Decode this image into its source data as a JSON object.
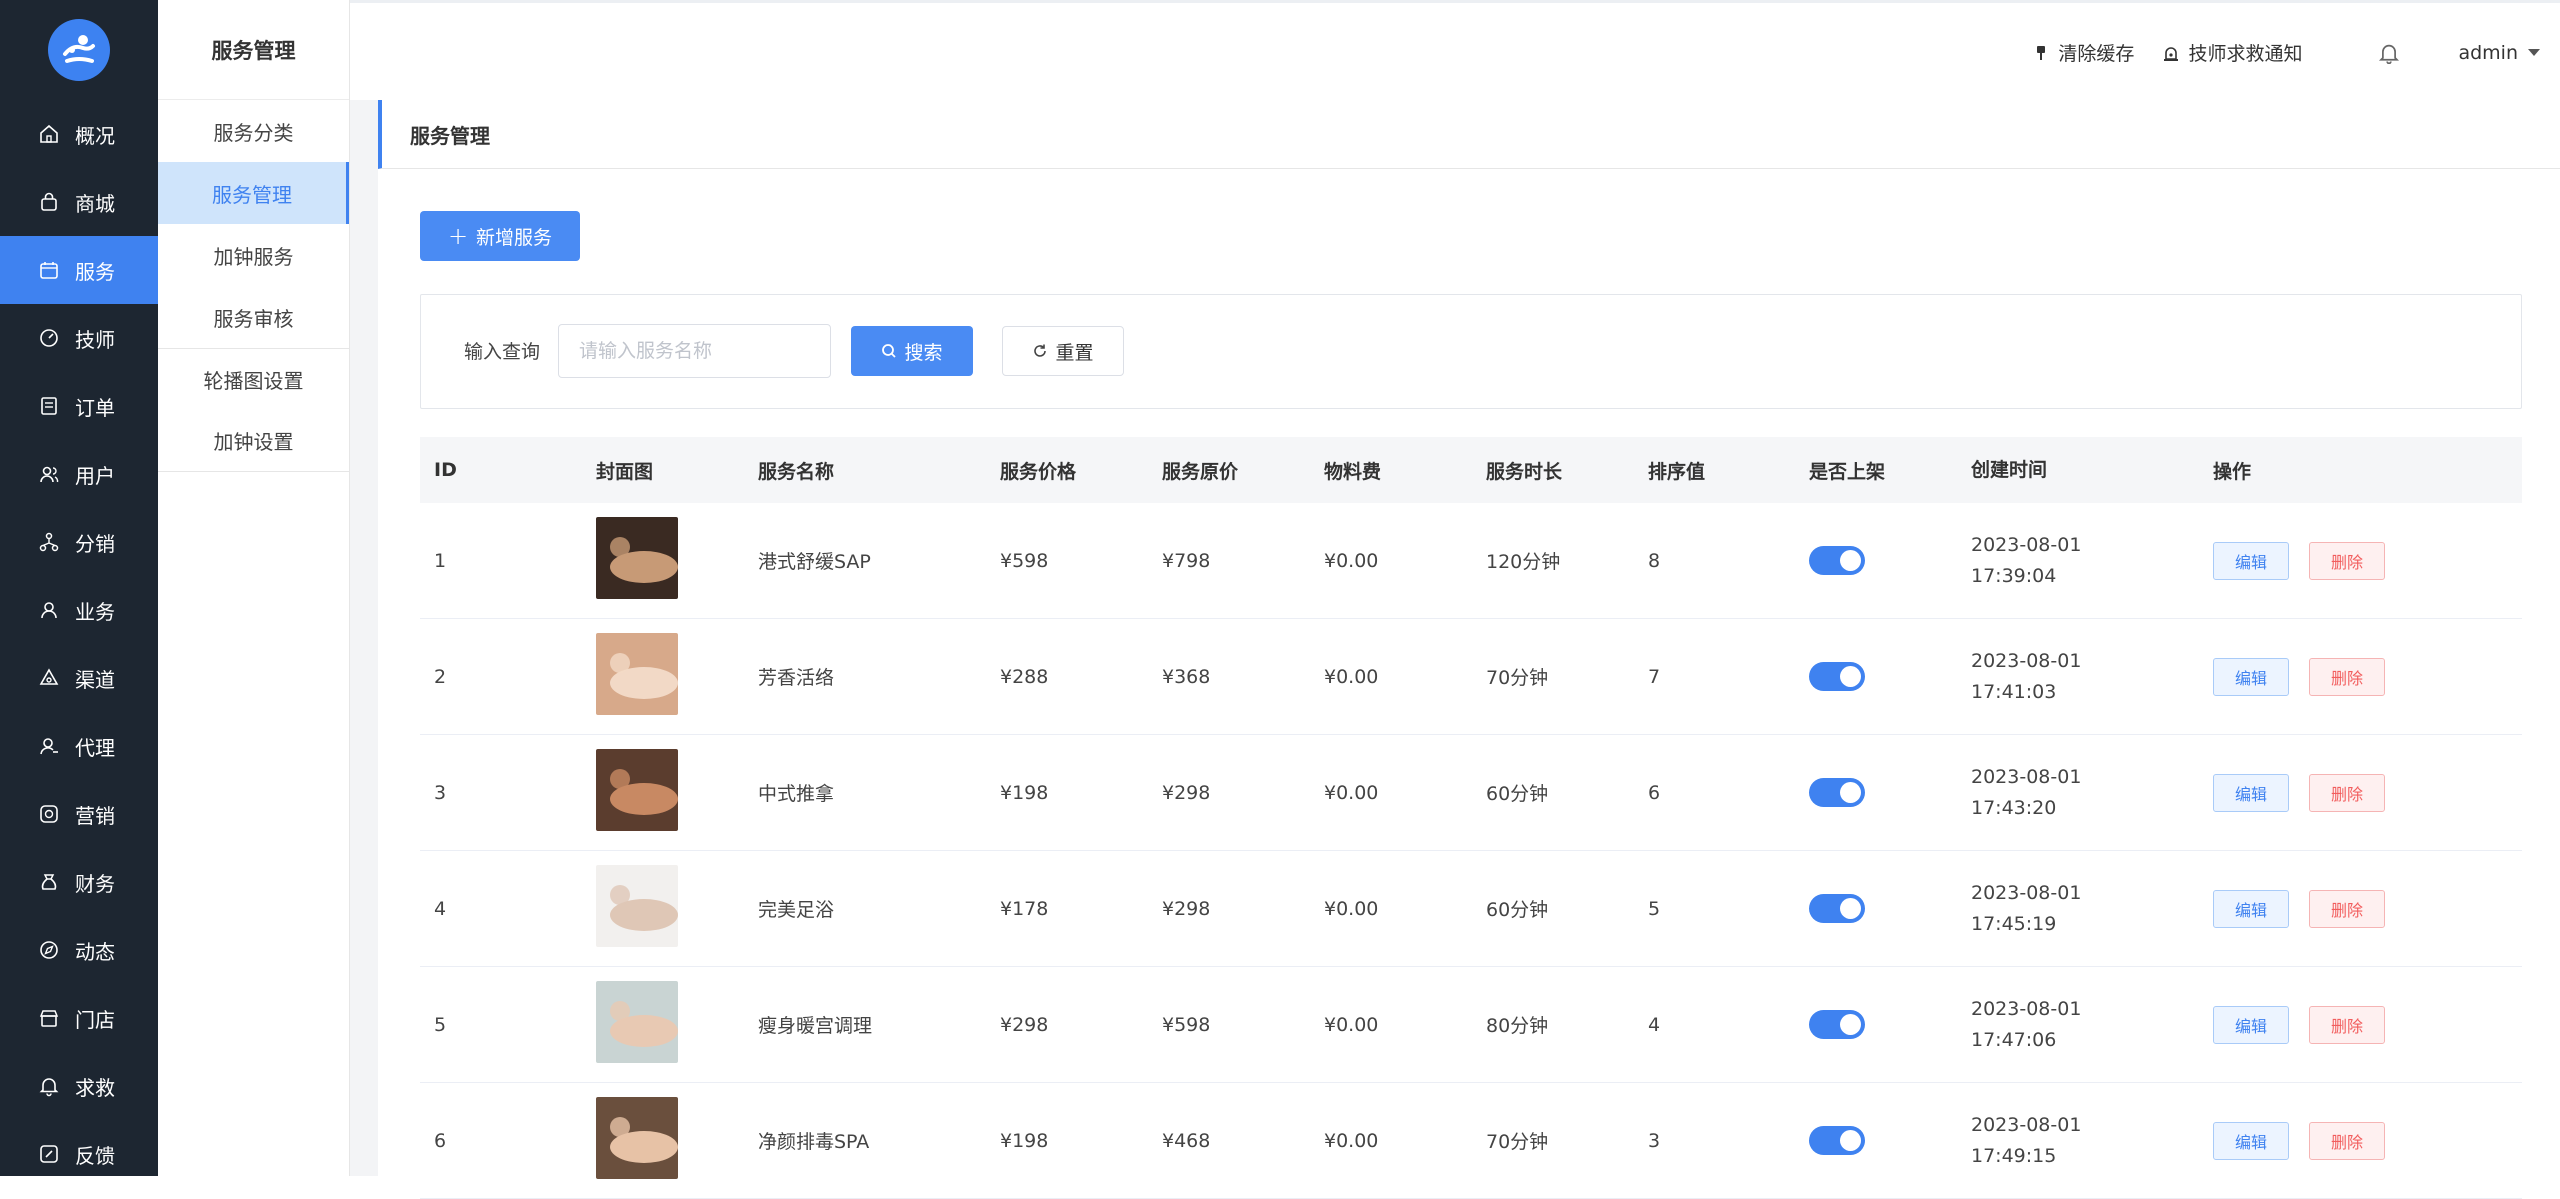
{
  "sidebar": {
    "items": [
      {
        "label": "概况",
        "icon": "home-icon"
      },
      {
        "label": "商城",
        "icon": "shopping-bag-icon"
      },
      {
        "label": "服务",
        "icon": "calendar-icon"
      },
      {
        "label": "技师",
        "icon": "dashboard-icon"
      },
      {
        "label": "订单",
        "icon": "document-icon"
      },
      {
        "label": "用户",
        "icon": "users-icon"
      },
      {
        "label": "分销",
        "icon": "network-icon"
      },
      {
        "label": "业务",
        "icon": "user-icon"
      },
      {
        "label": "渠道",
        "icon": "channel-icon"
      },
      {
        "label": "代理",
        "icon": "agent-icon"
      },
      {
        "label": "营销",
        "icon": "marketing-icon"
      },
      {
        "label": "财务",
        "icon": "money-bag-icon"
      },
      {
        "label": "动态",
        "icon": "compass-icon"
      },
      {
        "label": "门店",
        "icon": "store-icon"
      },
      {
        "label": "求救",
        "icon": "bell-icon"
      },
      {
        "label": "反馈",
        "icon": "feedback-icon"
      }
    ],
    "active": "服务"
  },
  "submenu": {
    "title": "服务管理",
    "items": [
      "服务分类",
      "服务管理",
      "加钟服务",
      "服务审核",
      "轮播图设置",
      "加钟设置"
    ],
    "active": "服务管理"
  },
  "topbar": {
    "clear_cache": "清除缓存",
    "rescue_notice": "技师求救通知",
    "user": "admin"
  },
  "breadcrumb": "服务管理",
  "actions": {
    "add_label": "新增服务"
  },
  "search": {
    "label": "输入查询",
    "placeholder": "请输入服务名称",
    "search_label": "搜索",
    "reset_label": "重置"
  },
  "table": {
    "headers": [
      "ID",
      "封面图",
      "服务名称",
      "服务价格",
      "服务原价",
      "物料费",
      "服务时长",
      "排序值",
      "是否上架",
      "创建时间",
      "操作"
    ],
    "edit_label": "编辑",
    "delete_label": "删除",
    "rows": [
      {
        "id": "1",
        "name": "港式舒缓SAP",
        "price": "¥598",
        "orig": "¥798",
        "material": "¥0.00",
        "duration": "120分钟",
        "sort": "8",
        "on_shelf": true,
        "date": "2023-08-01",
        "time": "17:39:04"
      },
      {
        "id": "2",
        "name": "芳香活络",
        "price": "¥288",
        "orig": "¥368",
        "material": "¥0.00",
        "duration": "70分钟",
        "sort": "7",
        "on_shelf": true,
        "date": "2023-08-01",
        "time": "17:41:03"
      },
      {
        "id": "3",
        "name": "中式推拿",
        "price": "¥198",
        "orig": "¥298",
        "material": "¥0.00",
        "duration": "60分钟",
        "sort": "6",
        "on_shelf": true,
        "date": "2023-08-01",
        "time": "17:43:20"
      },
      {
        "id": "4",
        "name": "完美足浴",
        "price": "¥178",
        "orig": "¥298",
        "material": "¥0.00",
        "duration": "60分钟",
        "sort": "5",
        "on_shelf": true,
        "date": "2023-08-01",
        "time": "17:45:19"
      },
      {
        "id": "5",
        "name": "瘦身暖宫调理",
        "price": "¥298",
        "orig": "¥598",
        "material": "¥0.00",
        "duration": "80分钟",
        "sort": "4",
        "on_shelf": true,
        "date": "2023-08-01",
        "time": "17:47:06"
      },
      {
        "id": "6",
        "name": "净颜排毒SPA",
        "price": "¥198",
        "orig": "¥468",
        "material": "¥0.00",
        "duration": "70分钟",
        "sort": "3",
        "on_shelf": true,
        "date": "2023-08-01",
        "time": "17:49:15"
      }
    ]
  }
}
